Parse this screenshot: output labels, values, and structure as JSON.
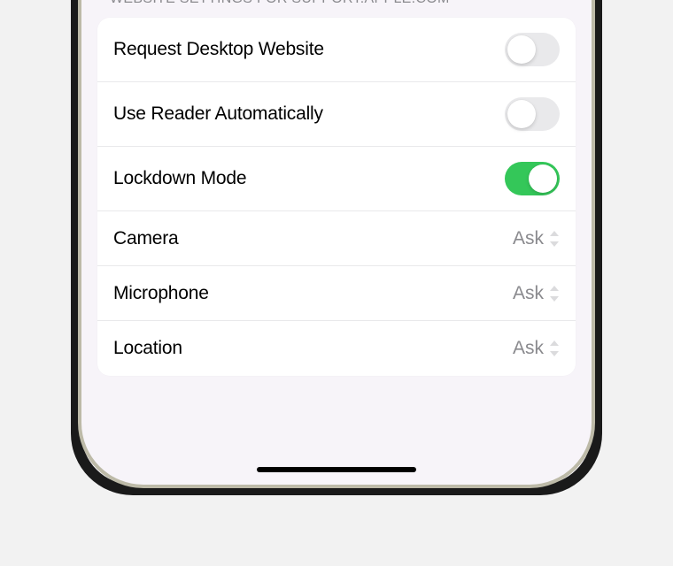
{
  "header": {
    "title": "WEBSITE SETTINGS FOR SUPPORT.APPLE.COM"
  },
  "settings": {
    "rows": [
      {
        "label": "Request Desktop Website",
        "type": "toggle",
        "value": "off"
      },
      {
        "label": "Use Reader Automatically",
        "type": "toggle",
        "value": "off"
      },
      {
        "label": "Lockdown Mode",
        "type": "toggle",
        "value": "on"
      },
      {
        "label": "Camera",
        "type": "select",
        "value": "Ask"
      },
      {
        "label": "Microphone",
        "type": "select",
        "value": "Ask"
      },
      {
        "label": "Location",
        "type": "select",
        "value": "Ask"
      }
    ]
  },
  "colors": {
    "toggle_on": "#34c759",
    "toggle_off": "#e9e9eb",
    "background": "#f7f4f9",
    "secondary_text": "#8a8a8e"
  }
}
